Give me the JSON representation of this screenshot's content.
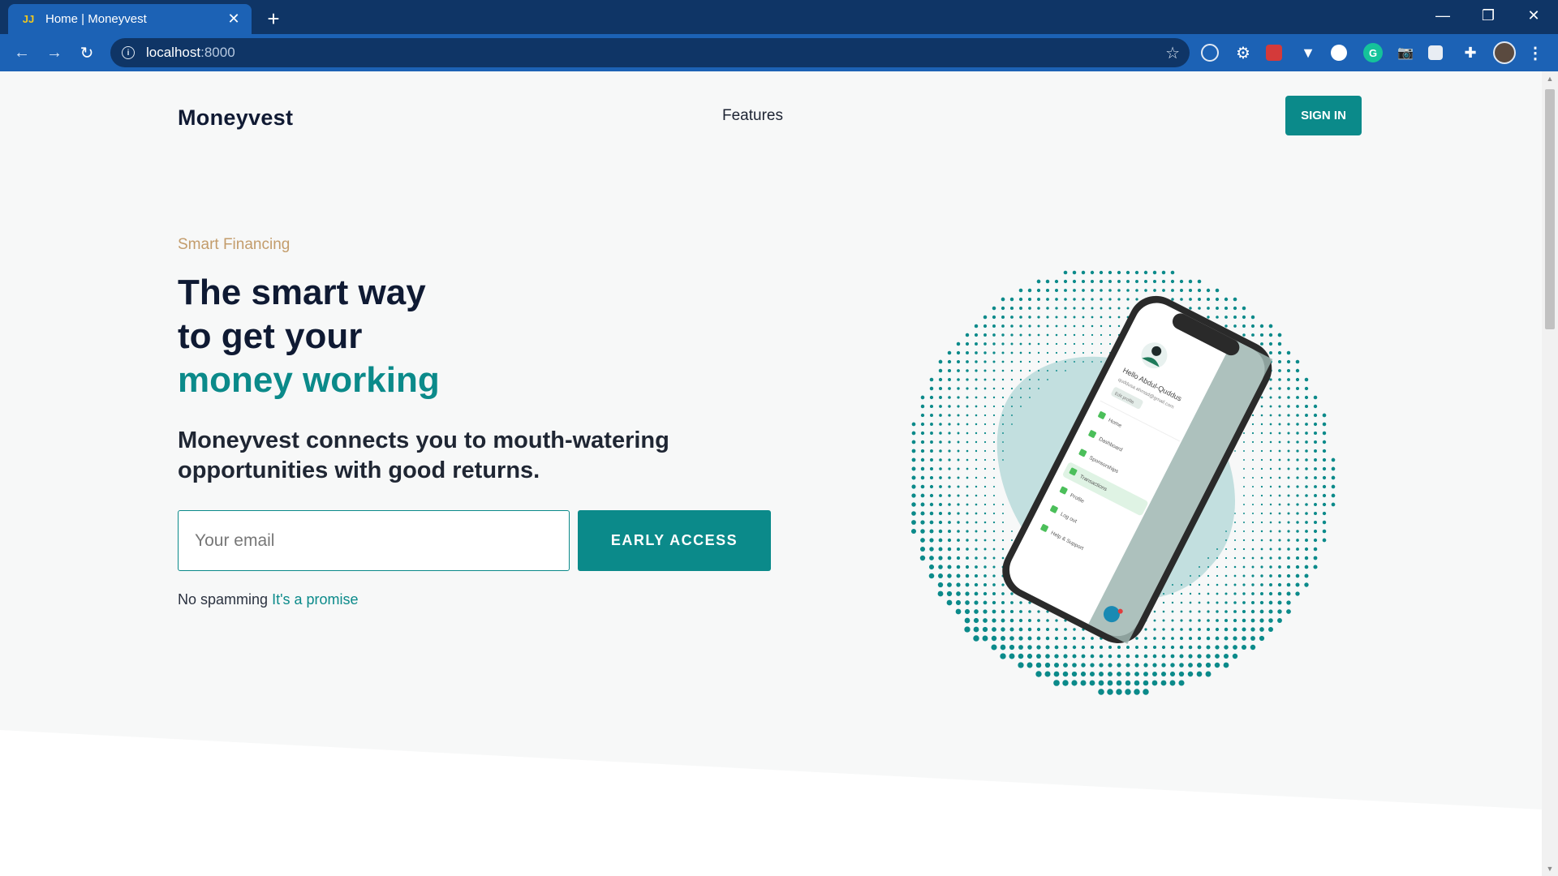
{
  "browser": {
    "tab_title": "Home | Moneyvest",
    "favicon_text": "JJ",
    "url_host": "localhost",
    "url_port": ":8000",
    "colors": {
      "frame": "#0f3566",
      "toolbar": "#1c62b5"
    },
    "extensions": [
      "target-icon",
      "gear-icon",
      "puzzle-red-icon",
      "vue-icon",
      "chrome-ext-icon",
      "grammarly-icon",
      "camera-icon",
      "tab-icon",
      "extensions-icon",
      "profile-avatar",
      "menu-icon"
    ]
  },
  "nav": {
    "logo": "Moneyvest",
    "features": "Features",
    "signin": "SIGN IN"
  },
  "hero": {
    "eyebrow": "Smart Financing",
    "headline_line1": "The smart way",
    "headline_line2": "to get your",
    "headline_accent": "money working",
    "subhead": "Moneyvest connects you to mouth-watering opportunities with good returns.",
    "email_placeholder": "Your email",
    "cta": "EARLY ACCESS",
    "note": "No spamming",
    "note_link": "It's a promise"
  },
  "phone": {
    "greeting": "Hello Abdul-Quddus",
    "email": "quddusa.ahmad@gmail.com",
    "edit_profile": "Edit profile",
    "menu": [
      "Home",
      "Dashboard",
      "Sponsorships",
      "Transactions",
      "Profile",
      "Log out",
      "Help & Support"
    ],
    "active_item": "Transactions"
  },
  "colors": {
    "accent": "#0b8a8a",
    "eyebrow": "#c39c6b",
    "heading": "#0f1a33",
    "background": "#f7f8f8"
  }
}
